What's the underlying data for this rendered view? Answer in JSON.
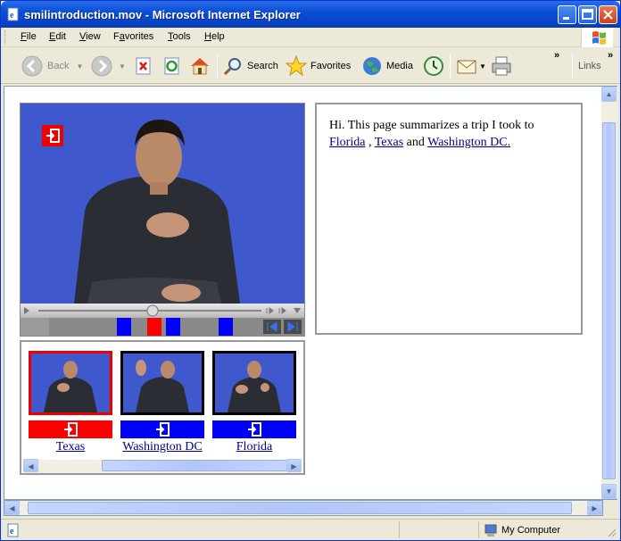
{
  "window": {
    "title": "smilintroduction.mov - Microsoft Internet Explorer"
  },
  "menu": [
    "File",
    "Edit",
    "View",
    "Favorites",
    "Tools",
    "Help"
  ],
  "menu_underline": [
    "F",
    "E",
    "V",
    "a",
    "T",
    "H"
  ],
  "toolbar": {
    "back": "Back",
    "search": "Search",
    "favorites": "Favorites",
    "media": "Media",
    "links": "Links"
  },
  "content": {
    "intro": "Hi. This page summarizes a trip I took to",
    "link_florida": "Florida",
    "comma": ",",
    "link_texas": "Texas",
    "and": "and",
    "link_dc": "Washington DC."
  },
  "thumbnails": [
    {
      "label": "Texas",
      "selected": true,
      "color": "#ff0000"
    },
    {
      "label": "Washington DC",
      "selected": false,
      "color": "#0000ff"
    },
    {
      "label": "Florida",
      "selected": false,
      "color": "#0000ff"
    }
  ],
  "status": {
    "zone": "My Computer"
  }
}
